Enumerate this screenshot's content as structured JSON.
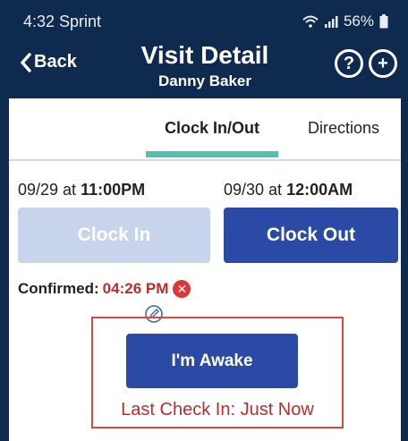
{
  "status_bar": {
    "time": "4:32 Sprint",
    "battery": "56%"
  },
  "header": {
    "back_label": "Back",
    "title": "Visit Detail",
    "subtitle": "Danny Baker",
    "help_icon": "question-circle-icon",
    "add_icon": "plus-circle-icon"
  },
  "tabs": [
    {
      "label": "Clock In/Out",
      "active": true
    },
    {
      "label": "Directions",
      "active": false
    }
  ],
  "clock": {
    "start_date": "09/29 at ",
    "start_time": "11:00PM",
    "end_date": "09/30 at ",
    "end_time": "12:00AM",
    "clock_in_label": "Clock In",
    "clock_out_label": "Clock Out",
    "confirmed_label": "Confirmed:",
    "confirmed_time": "04:26 PM",
    "awake_label": "I'm Awake",
    "last_check_in": "Last Check In: Just Now"
  },
  "colors": {
    "header_bg": "#0e2a4f",
    "primary_button": "#2b4aa5",
    "disabled_button": "#c7d4ec",
    "tab_indicator": "#4fc2b3",
    "alert_red": "#c12a2a",
    "highlight_border": "#e0463f"
  }
}
